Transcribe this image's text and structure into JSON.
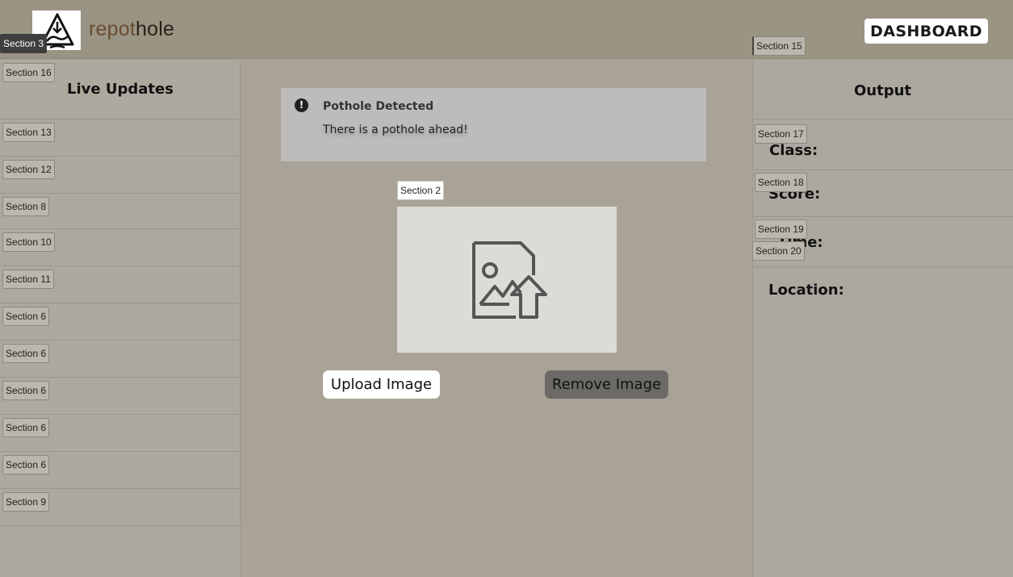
{
  "header": {
    "brand_part1": "repot",
    "brand_part2": "hole",
    "dashboard_label": "DASHBOARD"
  },
  "sections": {
    "s3": "Section 3",
    "s16": "Section 16",
    "s13": "Section 13",
    "s12": "Section 12",
    "s8": "Section 8",
    "s10": "Section 10",
    "s11": "Section 11",
    "s6": "Section 6",
    "s9": "Section 9",
    "s2": "Section 2",
    "s15": "Section 15",
    "s17": "Section 17",
    "s18": "Section 18",
    "s19": "Section 19",
    "s20": "Section 20"
  },
  "left_panel": {
    "title": "Live Updates"
  },
  "alert": {
    "icon": "alert-circle-icon",
    "title": "Pothole Detected",
    "message": "There is a pothole ahead!"
  },
  "upload": {
    "icon": "image-upload-icon",
    "upload_label": "Upload Image",
    "remove_label": "Remove Image"
  },
  "output": {
    "title": "Output",
    "class_label": "Class:",
    "score_label": "Score:",
    "time_label": "Time:",
    "location_label": "Location:"
  },
  "colors": {
    "page_bg": "#a8a396",
    "header_bg": "#9a9484",
    "brand_light": "#6a4d33",
    "remove_button": "#6b6a67"
  }
}
